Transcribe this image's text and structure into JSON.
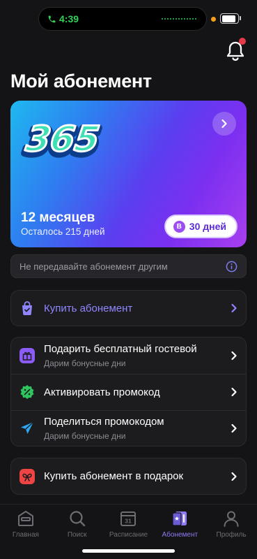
{
  "status_bar": {
    "time": "4:39",
    "battery_level": 0.9
  },
  "page": {
    "title": "Мой абонемент"
  },
  "subscription_card": {
    "logo_text": "365",
    "period": "12 месяцев",
    "remaining": "Осталось 215 дней",
    "bonus_icon_letter": "B",
    "bonus": "30 дней",
    "gradient": [
      "#1fb8f0",
      "#5a3ff0",
      "#a83ff0"
    ]
  },
  "notice": {
    "text": "Не передавайте абонемент другим"
  },
  "buy": {
    "label": "Купить абонемент",
    "accent": "#8f86ff"
  },
  "menu": [
    {
      "title": "Подарить бесплатный гостевой",
      "subtitle": "Дарим бонусные дни",
      "icon": "gift-icon",
      "color": "#8b5cf6"
    },
    {
      "title": "Активировать промокод",
      "subtitle": "",
      "icon": "promo-badge-icon",
      "color": "#2fc55e"
    },
    {
      "title": "Поделиться промокодом",
      "subtitle": "Дарим бонусные дни",
      "icon": "send-icon",
      "color": "#2ea7f0"
    }
  ],
  "gift": {
    "label": "Купить абонемент в подарок",
    "icon": "gift-bow-icon",
    "color": "#ef4444"
  },
  "tabs": [
    {
      "label": "Главная",
      "icon": "home-icon",
      "active": false
    },
    {
      "label": "Поиск",
      "icon": "search-icon",
      "active": false
    },
    {
      "label": "Расписание",
      "icon": "calendar-icon",
      "calendar_day": "31",
      "active": false
    },
    {
      "label": "Абонемент",
      "icon": "membership-card-icon",
      "active": true
    },
    {
      "label": "Профиль",
      "icon": "profile-icon",
      "active": false
    }
  ]
}
